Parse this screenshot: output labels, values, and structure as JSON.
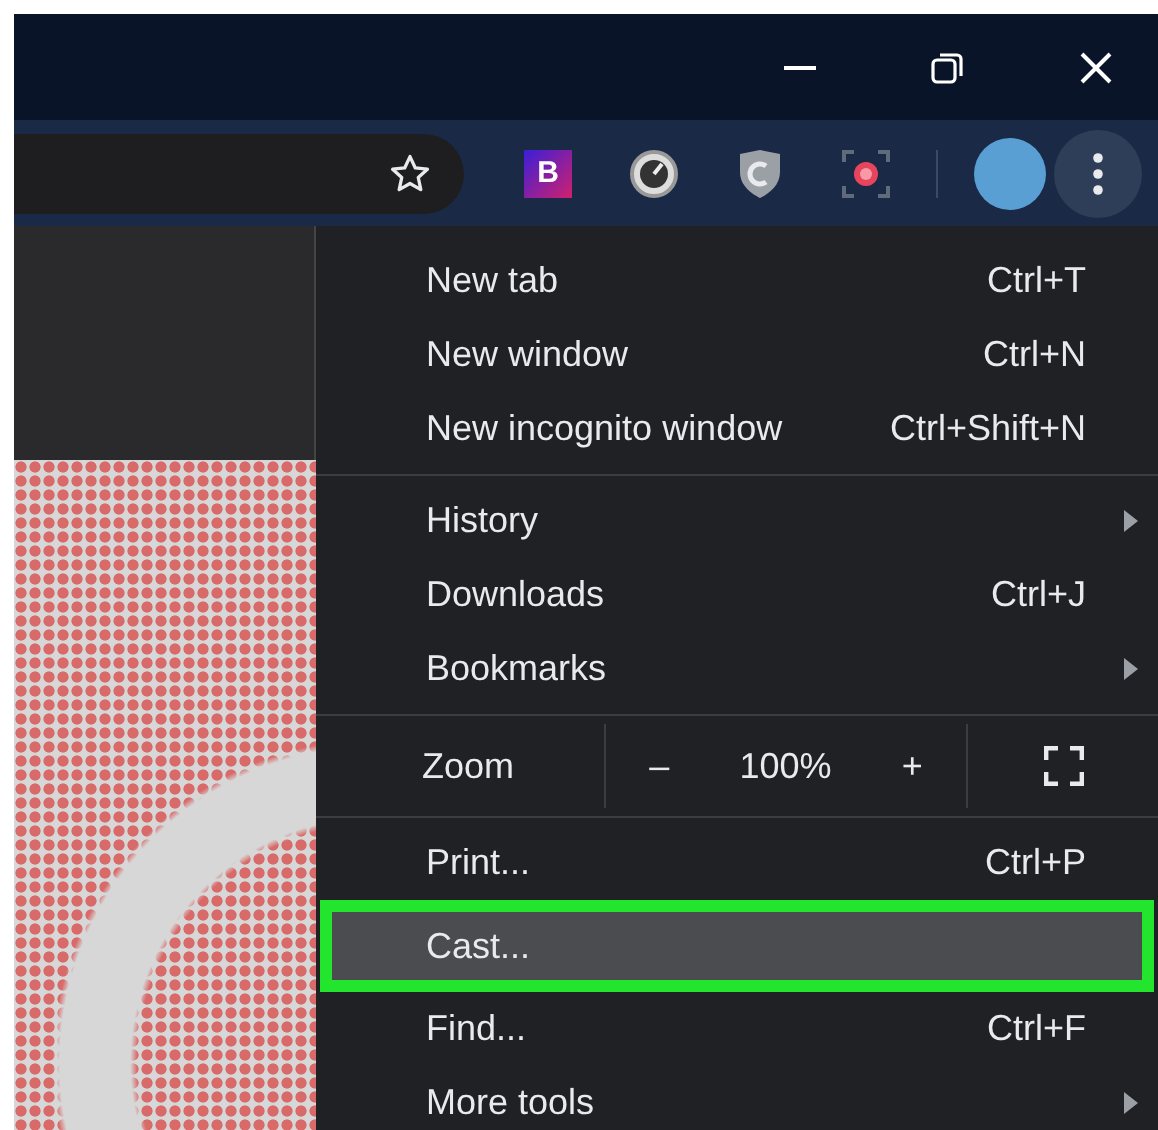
{
  "toolbar": {
    "extension_letter": "B"
  },
  "menu": {
    "sections": [
      {
        "items": [
          {
            "kind": "item",
            "label": "New tab",
            "shortcut": "Ctrl+T",
            "submenu": false,
            "selected": false
          },
          {
            "kind": "item",
            "label": "New window",
            "shortcut": "Ctrl+N",
            "submenu": false,
            "selected": false
          },
          {
            "kind": "item",
            "label": "New incognito window",
            "shortcut": "Ctrl+Shift+N",
            "submenu": false,
            "selected": false
          }
        ]
      },
      {
        "items": [
          {
            "kind": "item",
            "label": "History",
            "submenu": true,
            "selected": false
          },
          {
            "kind": "item",
            "label": "Downloads",
            "shortcut": "Ctrl+J",
            "submenu": false,
            "selected": false
          },
          {
            "kind": "item",
            "label": "Bookmarks",
            "submenu": true,
            "selected": false
          }
        ]
      },
      {
        "items": [
          {
            "kind": "zoom",
            "label": "Zoom",
            "minus": "–",
            "value": "100%",
            "plus": "+"
          }
        ]
      },
      {
        "items": [
          {
            "kind": "item",
            "label": "Print...",
            "shortcut": "Ctrl+P",
            "submenu": false,
            "selected": false
          },
          {
            "kind": "item",
            "label": "Cast...",
            "submenu": false,
            "selected": true
          },
          {
            "kind": "item",
            "label": "Find...",
            "shortcut": "Ctrl+F",
            "submenu": false,
            "selected": false
          },
          {
            "kind": "item",
            "label": "More tools",
            "submenu": true,
            "selected": false
          }
        ]
      }
    ]
  }
}
